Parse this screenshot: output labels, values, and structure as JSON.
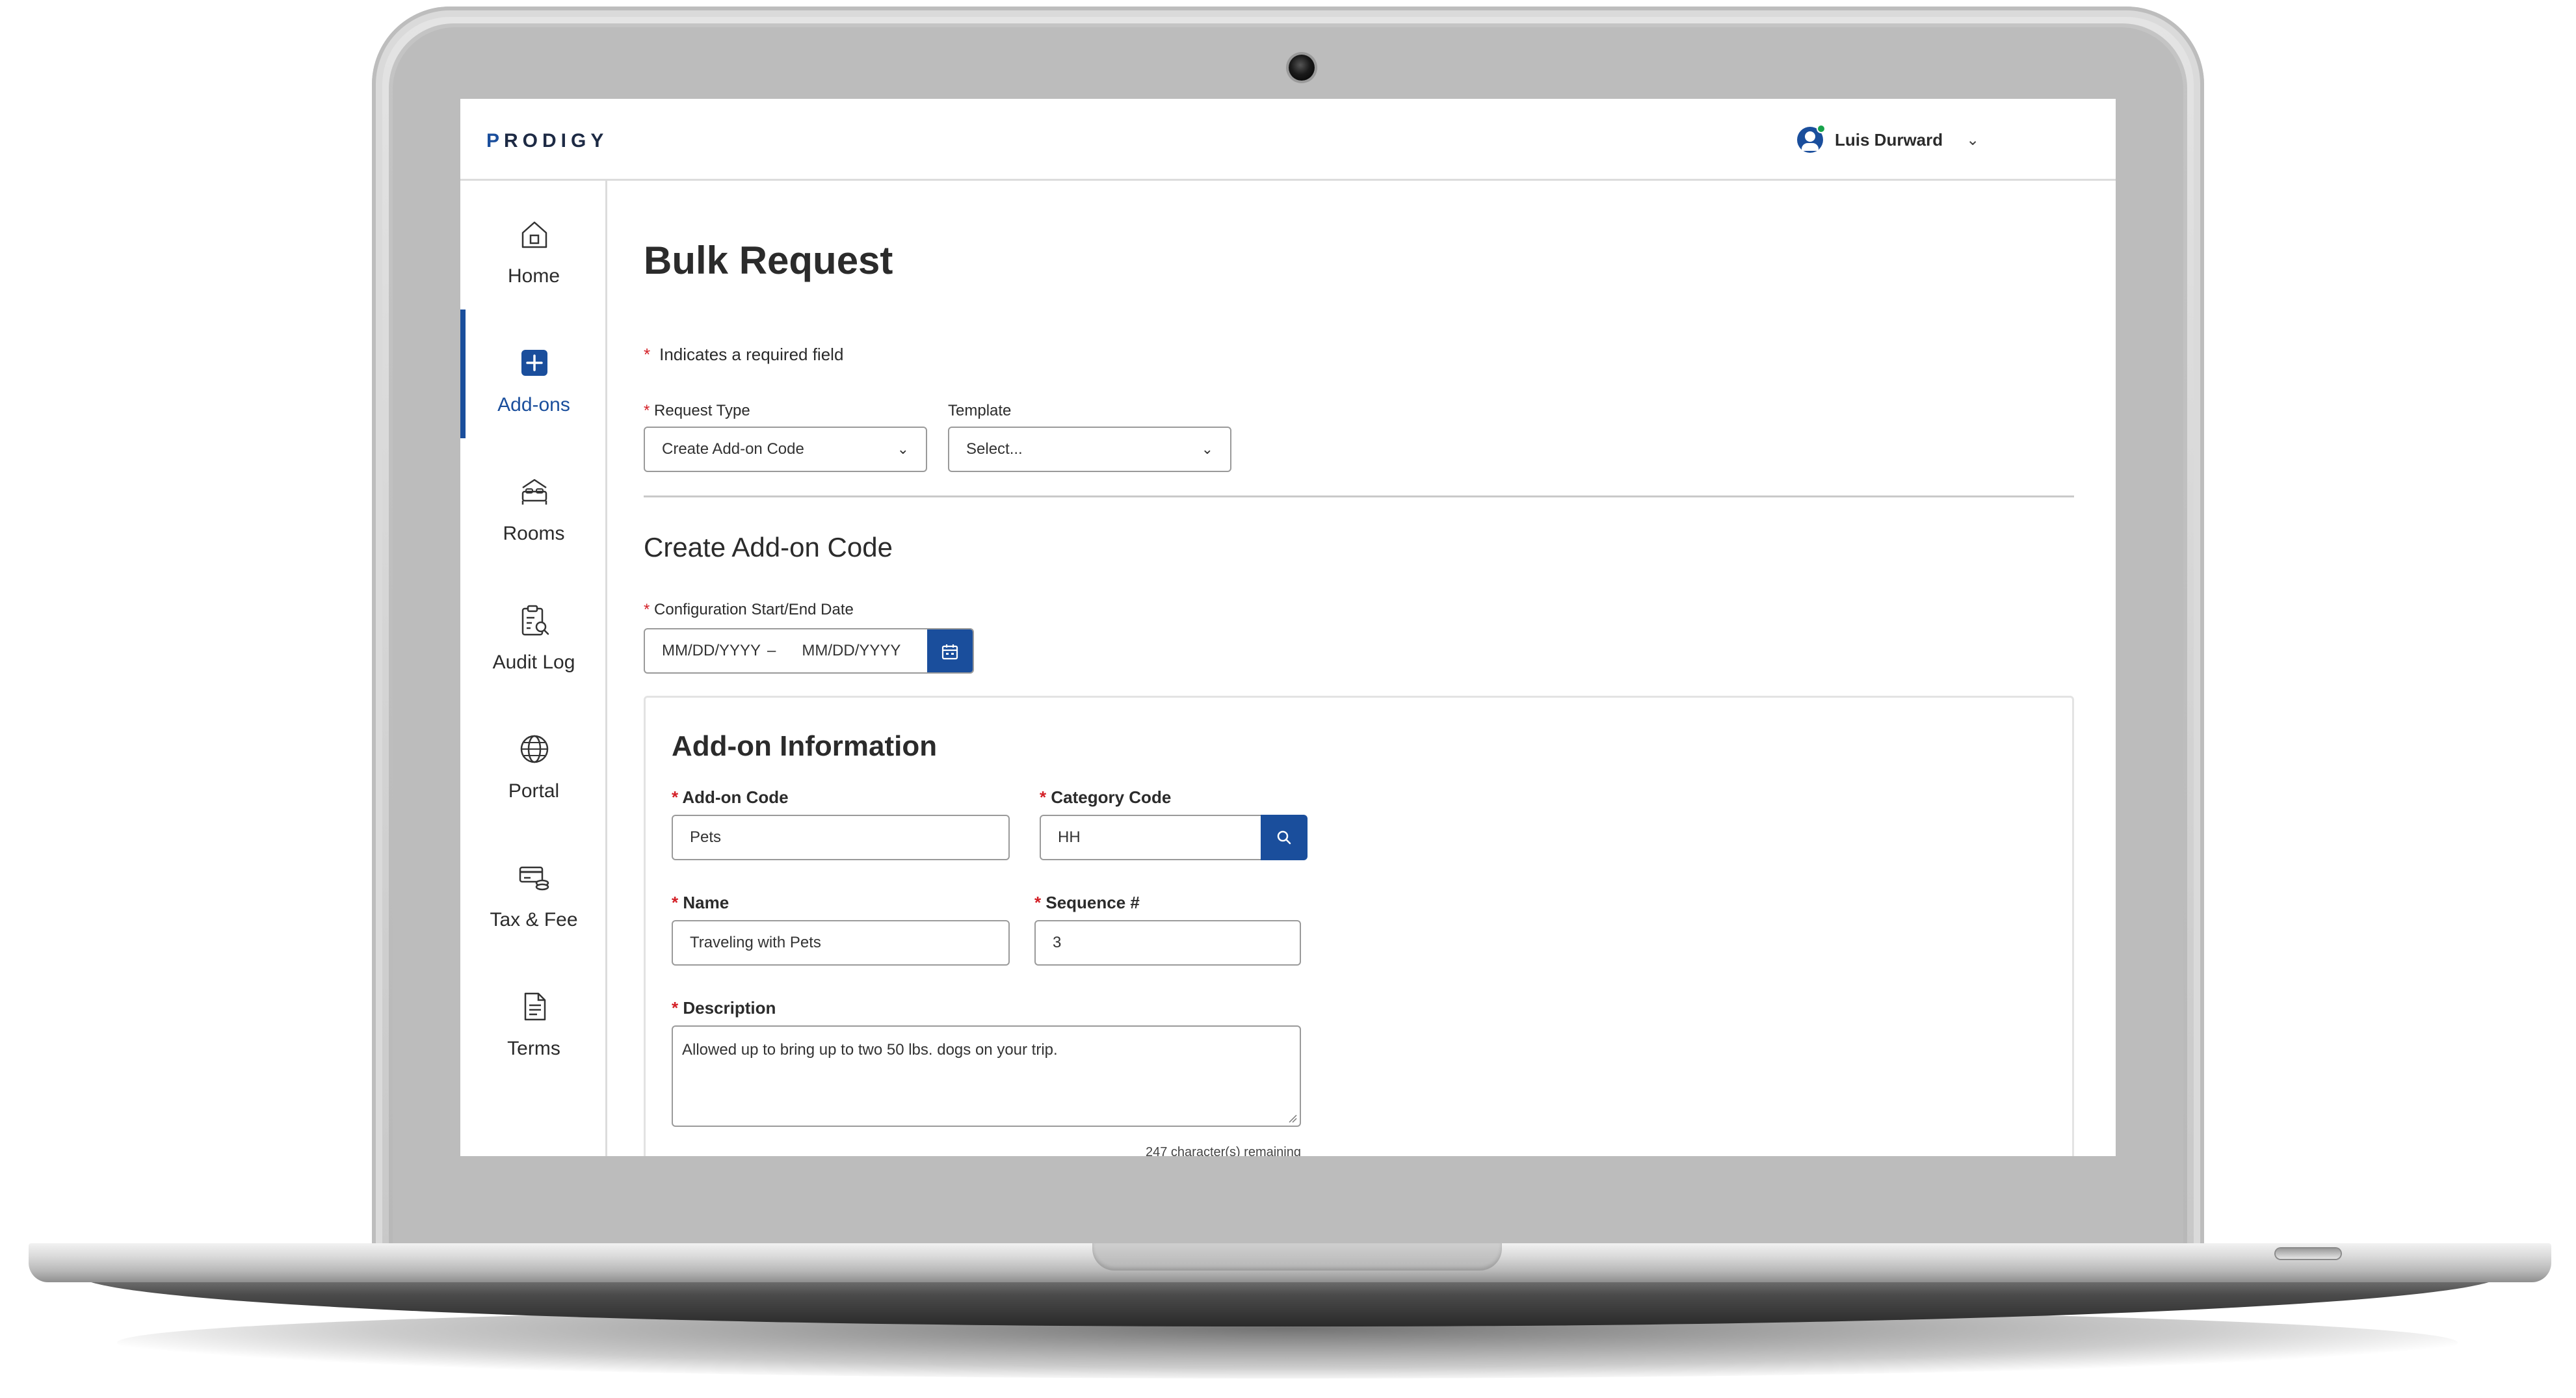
{
  "app": {
    "logo_text": "PRODIGY",
    "brand_color": "#1a4e9c",
    "user": {
      "name": "Luis Durward",
      "avatar_icon": "user-avatar-icon",
      "status_color": "#17a34a"
    }
  },
  "sidebar": {
    "items": [
      {
        "label": "Home",
        "icon": "home-icon",
        "active": false
      },
      {
        "label": "Add-ons",
        "icon": "plus-square-icon",
        "active": true
      },
      {
        "label": "Rooms",
        "icon": "bed-icon",
        "active": false
      },
      {
        "label": "Audit Log",
        "icon": "clipboard-search-icon",
        "active": false
      },
      {
        "label": "Portal",
        "icon": "globe-icon",
        "active": false
      },
      {
        "label": "Tax & Fee",
        "icon": "card-coins-icon",
        "active": false
      },
      {
        "label": "Terms",
        "icon": "document-icon",
        "active": false
      }
    ]
  },
  "page": {
    "title": "Bulk Request",
    "required_marker": "*",
    "required_note": "Indicates a required field",
    "request_type": {
      "label": "Request Type",
      "value": "Create Add-on Code"
    },
    "template": {
      "label": "Template",
      "value": "Select..."
    },
    "section_title": "Create Add-on Code",
    "config_dates": {
      "label": "Configuration Start/End Date",
      "start_placeholder": "MM/DD/YYYY",
      "separator": "–",
      "end_placeholder": "MM/DD/YYYY"
    }
  },
  "addon_info": {
    "title": "Add-on Information",
    "addon_code": {
      "label": "Add-on Code",
      "value": "Pets"
    },
    "category_code": {
      "label": "Category Code",
      "value": "HH"
    },
    "name": {
      "label": "Name",
      "value": "Traveling with Pets"
    },
    "sequence": {
      "label": "Sequence #",
      "value": "3"
    },
    "description": {
      "label": "Description",
      "value": "Allowed up to bring up to two 50 lbs. dogs on your trip.",
      "remaining": "247 character(s) remaining"
    }
  }
}
